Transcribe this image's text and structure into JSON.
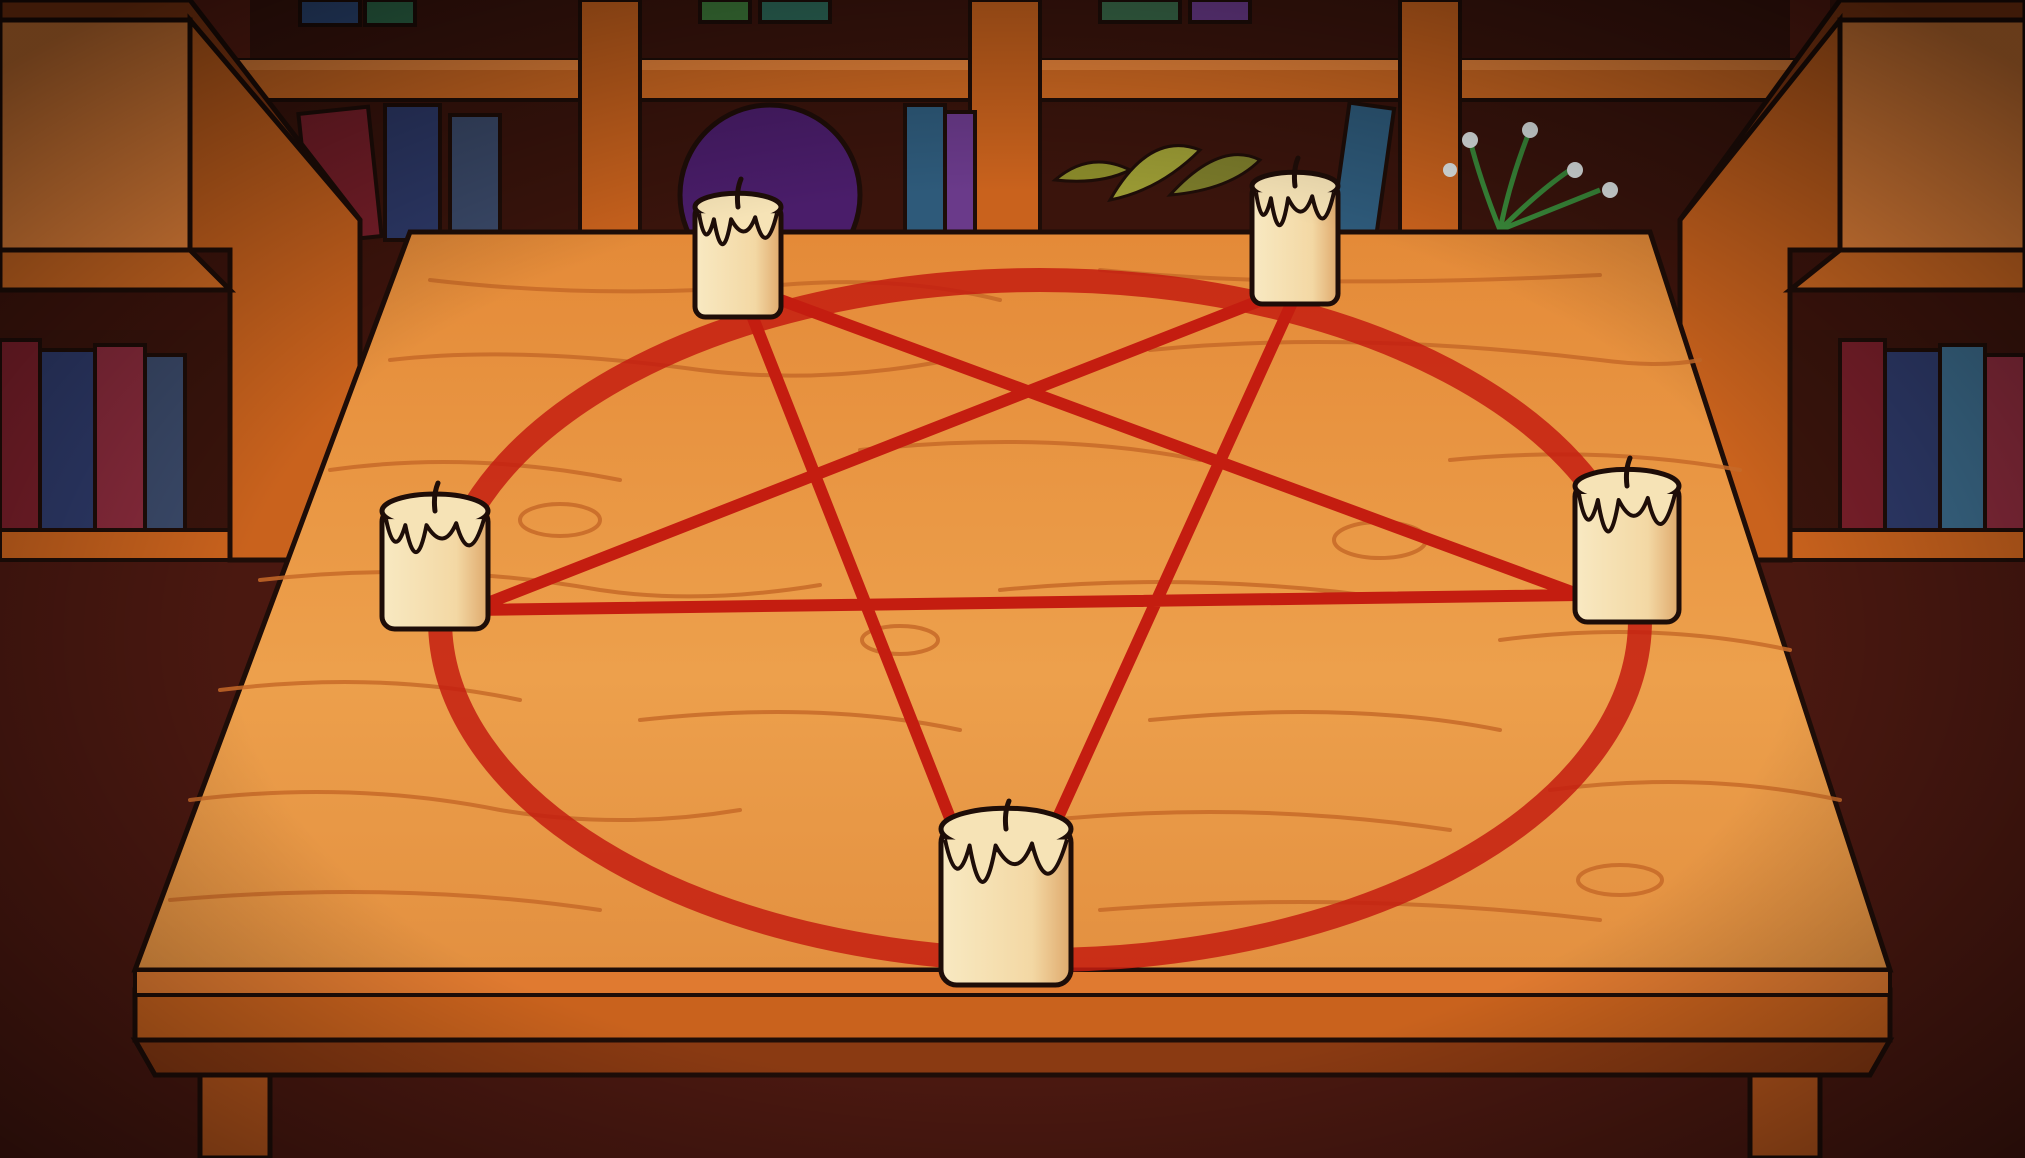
{
  "scene": {
    "name": "ritual-table-scene"
  },
  "colors": {
    "backdrop_dark": "#3a120c",
    "backdrop_mid": "#5a1d12",
    "shelf_wood": "#c9621d",
    "shelf_wood_light": "#e8843a",
    "shelf_wood_dark": "#8a3a12",
    "table_top": "#e8923e",
    "table_top_light": "#f2a650",
    "table_edge": "#d2742c",
    "table_grain": "#c9702c",
    "pentagram_red": "#c41d10",
    "candle_wax": "#f6e3b6",
    "candle_shadow": "#e2b27a",
    "outline": "#1e0d08"
  },
  "books": [
    {
      "color": "#7a1f2a"
    },
    {
      "color": "#2e3a6a"
    },
    {
      "color": "#3b6a8a"
    },
    {
      "color": "#6a3a8a"
    },
    {
      "color": "#2e5a7a"
    },
    {
      "color": "#8a2b3c"
    }
  ],
  "candles": [
    {
      "name": "candle-top-left"
    },
    {
      "name": "candle-top-right"
    },
    {
      "name": "candle-left"
    },
    {
      "name": "candle-right"
    },
    {
      "name": "candle-bottom"
    }
  ]
}
